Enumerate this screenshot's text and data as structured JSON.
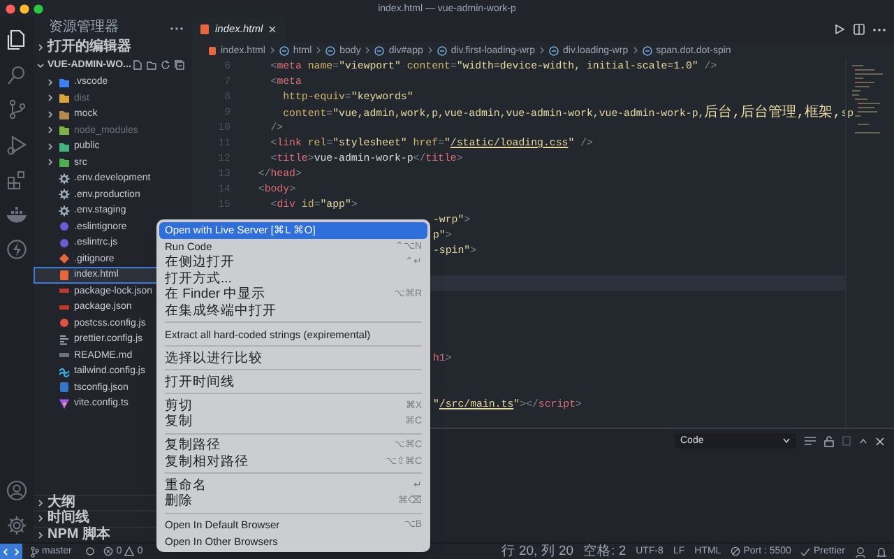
{
  "window": {
    "title": "index.html — vue-admin-work-p"
  },
  "activity_bar": [
    {
      "kind": "files",
      "selected": true
    },
    {
      "kind": "search",
      "selected": false
    },
    {
      "kind": "branch",
      "selected": false
    },
    {
      "kind": "run",
      "selected": false
    },
    {
      "kind": "extensions",
      "selected": false
    },
    {
      "kind": "whale",
      "selected": false
    },
    {
      "kind": "bolt",
      "selected": false
    }
  ],
  "activity_bar_bottom": [
    {
      "kind": "account"
    },
    {
      "kind": "gear"
    }
  ],
  "sidebar": {
    "title": "资源管理器",
    "open_editors": {
      "label": "打开的编辑器",
      "expanded": false
    },
    "project": {
      "label": "VUE-ADMIN-WO...",
      "expanded": true
    },
    "items": [
      {
        "name": ".vscode",
        "kind": "folder",
        "color": "#3b82f6",
        "dimmed": false,
        "selected": false
      },
      {
        "name": "dist",
        "kind": "folder",
        "color": "#d9a53a",
        "dimmed": true,
        "selected": false
      },
      {
        "name": "mock",
        "kind": "folder",
        "color": "#b58a4c",
        "dimmed": false,
        "selected": false
      },
      {
        "name": "node_modules",
        "kind": "folder",
        "color": "#7cb342",
        "dimmed": true,
        "selected": false
      },
      {
        "name": "public",
        "kind": "folder",
        "color": "#43b581",
        "dimmed": false,
        "selected": false
      },
      {
        "name": "src",
        "kind": "folder",
        "color": "#4caf50",
        "dimmed": false,
        "selected": false
      },
      {
        "name": ".env.development",
        "kind": "gear",
        "color": "#9fb0c0",
        "dimmed": false,
        "selected": false
      },
      {
        "name": ".env.production",
        "kind": "gear",
        "color": "#9fb0c0",
        "dimmed": false,
        "selected": false
      },
      {
        "name": ".env.staging",
        "kind": "gear",
        "color": "#9fb0c0",
        "dimmed": false,
        "selected": false
      },
      {
        "name": ".eslintignore",
        "kind": "dot",
        "color": "#6b5bd6",
        "dimmed": false,
        "selected": false
      },
      {
        "name": ".eslintrc.js",
        "kind": "dot",
        "color": "#6b5bd6",
        "dimmed": false,
        "selected": false
      },
      {
        "name": ".gitignore",
        "kind": "diamond",
        "color": "#e8663d",
        "dimmed": false,
        "selected": false
      },
      {
        "name": "index.html",
        "kind": "square",
        "color": "#e8663d",
        "dimmed": false,
        "selected": true
      },
      {
        "name": "package-lock.json",
        "kind": "bar",
        "color": "#c0392b",
        "dimmed": false,
        "selected": false
      },
      {
        "name": "package.json",
        "kind": "bar",
        "color": "#c0392b",
        "dimmed": false,
        "selected": false
      },
      {
        "name": "postcss.config.js",
        "kind": "dot",
        "color": "#e0523c",
        "dimmed": false,
        "selected": false
      },
      {
        "name": "prettier.config.js",
        "kind": "bars",
        "color": "#9ca3af",
        "dimmed": false,
        "selected": false
      },
      {
        "name": "README.md",
        "kind": "bar",
        "color": "#6b7280",
        "dimmed": false,
        "selected": false
      },
      {
        "name": "tailwind.config.js",
        "kind": "wave",
        "color": "#38bdf8",
        "dimmed": false,
        "selected": false
      },
      {
        "name": "tsconfig.json",
        "kind": "square",
        "color": "#3178c6",
        "dimmed": false,
        "selected": false
      },
      {
        "name": "vite.config.ts",
        "kind": "bolt",
        "color": "#a855f7",
        "dimmed": false,
        "selected": false
      }
    ],
    "sections": [
      {
        "label": "大纲",
        "expanded": false
      },
      {
        "label": "时间线",
        "expanded": false
      },
      {
        "label": "NPM 脚本",
        "expanded": false
      }
    ]
  },
  "tabs": [
    {
      "label": "index.html",
      "selected": true
    }
  ],
  "breadcrumbs": [
    "index.html",
    "html",
    "body",
    "div#app",
    "div.first-loading-wrp",
    "div.loading-wrp",
    "span.dot.dot-spin"
  ],
  "code_lines": [
    {
      "number": "6",
      "current": false,
      "tokens": [
        {
          "text": "    <",
          "kind": "punct"
        },
        {
          "text": "meta",
          "kind": "tag"
        },
        {
          "text": " name",
          "kind": "attr"
        },
        {
          "text": "=",
          "kind": "punct"
        },
        {
          "text": "\"viewport\"",
          "kind": "string"
        },
        {
          "text": " content",
          "kind": "attr"
        },
        {
          "text": "=",
          "kind": "punct"
        },
        {
          "text": "\"width=device-width, initial-scale=1.0\"",
          "kind": "string"
        },
        {
          "text": " />",
          "kind": "punct"
        }
      ]
    },
    {
      "number": "7",
      "current": false,
      "tokens": [
        {
          "text": "    <",
          "kind": "punct"
        },
        {
          "text": "meta",
          "kind": "tag"
        }
      ]
    },
    {
      "number": "8",
      "current": false,
      "tokens": [
        {
          "text": "      http-equiv",
          "kind": "attr"
        },
        {
          "text": "=",
          "kind": "punct"
        },
        {
          "text": "\"keywords\"",
          "kind": "string"
        }
      ]
    },
    {
      "number": "9",
      "current": false,
      "tokens": [
        {
          "text": "      content",
          "kind": "attr"
        },
        {
          "text": "=",
          "kind": "punct"
        },
        {
          "text": "\"vue,admin,work,p,vue-admin,vue-admin-work,vue-admin-work-p,",
          "kind": "string"
        },
        {
          "text": "后台,后台管理,框架,",
          "kind": "string"
        },
        {
          "text": "sp",
          "kind": "string"
        }
      ]
    },
    {
      "number": "10",
      "current": false,
      "tokens": [
        {
          "text": "    />",
          "kind": "punct"
        }
      ]
    },
    {
      "number": "11",
      "current": false,
      "tokens": [
        {
          "text": "    <",
          "kind": "punct"
        },
        {
          "text": "link",
          "kind": "tag"
        },
        {
          "text": " rel",
          "kind": "attr"
        },
        {
          "text": "=",
          "kind": "punct"
        },
        {
          "text": "\"stylesheet\"",
          "kind": "string"
        },
        {
          "text": " href",
          "kind": "attr"
        },
        {
          "text": "=",
          "kind": "punct"
        },
        {
          "text": "\"",
          "kind": "string"
        },
        {
          "text": "/static/loading.css",
          "kind": "link"
        },
        {
          "text": "\"",
          "kind": "string"
        },
        {
          "text": " />",
          "kind": "punct"
        }
      ]
    },
    {
      "number": "12",
      "current": false,
      "tokens": [
        {
          "text": "    <",
          "kind": "punct"
        },
        {
          "text": "title",
          "kind": "tag"
        },
        {
          "text": ">",
          "kind": "punct"
        },
        {
          "text": "vue-admin-work-p",
          "kind": "text"
        },
        {
          "text": "</",
          "kind": "punct"
        },
        {
          "text": "title",
          "kind": "tag"
        },
        {
          "text": ">",
          "kind": "punct"
        }
      ]
    },
    {
      "number": "13",
      "current": false,
      "tokens": [
        {
          "text": "  </",
          "kind": "punct"
        },
        {
          "text": "head",
          "kind": "tag"
        },
        {
          "text": ">",
          "kind": "punct"
        }
      ]
    },
    {
      "number": "14",
      "current": false,
      "tokens": [
        {
          "text": "  <",
          "kind": "punct"
        },
        {
          "text": "body",
          "kind": "tag"
        },
        {
          "text": ">",
          "kind": "punct"
        }
      ]
    },
    {
      "number": "15",
      "current": false,
      "tokens": [
        {
          "text": "    <",
          "kind": "punct"
        },
        {
          "text": "div",
          "kind": "tag"
        },
        {
          "text": " id",
          "kind": "attr"
        },
        {
          "text": "=",
          "kind": "punct"
        },
        {
          "text": "\"app\"",
          "kind": "string"
        },
        {
          "text": ">",
          "kind": "punct"
        }
      ]
    },
    {
      "current": false,
      "tail": [
        {
          "text": "-wrp\"",
          "kind": "string"
        },
        {
          "text": ">",
          "kind": "punct"
        }
      ]
    },
    {
      "current": false,
      "tail": [
        {
          "text": "p\"",
          "kind": "string"
        },
        {
          "text": ">",
          "kind": "punct"
        }
      ]
    },
    {
      "current": false,
      "tail": [
        {
          "text": "-spin\"",
          "kind": "string"
        },
        {
          "text": ">",
          "kind": "punct"
        }
      ]
    },
    {
      "current": false
    },
    {
      "current": true
    },
    {
      "current": false
    },
    {
      "current": false
    },
    {
      "current": false
    },
    {
      "current": false
    },
    {
      "current": false,
      "tail": [
        {
          "text": "h1",
          "kind": "tag"
        },
        {
          "text": ">",
          "kind": "punct"
        }
      ]
    },
    {
      "current": false
    },
    {
      "current": false
    },
    {
      "current": false,
      "tail": [
        {
          "text": "\"",
          "kind": "string"
        },
        {
          "text": "/src/main.ts",
          "kind": "link"
        },
        {
          "text": "\"",
          "kind": "string"
        },
        {
          "text": "></",
          "kind": "punct"
        },
        {
          "text": "script",
          "kind": "tag"
        },
        {
          "text": ">",
          "kind": "punct"
        }
      ]
    }
  ],
  "panel": {
    "dropdown": "Code"
  },
  "context_menu": {
    "groups": [
      {
        "items": [
          {
            "label": "Open with Live Server [⌘L ⌘O]",
            "selected": true
          },
          {
            "label": "Run Code",
            "shortcut": "⌃⌥N",
            "selected": false
          },
          {
            "label": "在侧边打开",
            "shortcut": "⌃↵",
            "selected": false
          },
          {
            "label": "打开方式...",
            "selected": false
          },
          {
            "label": "在 Finder 中显示",
            "shortcut": "⌥⌘R",
            "selected": false
          },
          {
            "label": "在集成终端中打开",
            "selected": false
          }
        ]
      },
      {
        "items": [
          {
            "label": "Extract all hard-coded strings (expiremental)",
            "selected": false
          }
        ]
      },
      {
        "items": [
          {
            "label": "选择以进行比较",
            "selected": false
          }
        ]
      },
      {
        "items": [
          {
            "label": "打开时间线",
            "selected": false
          }
        ]
      },
      {
        "items": [
          {
            "label": "剪切",
            "shortcut": "⌘X",
            "selected": false
          },
          {
            "label": "复制",
            "shortcut": "⌘C",
            "selected": false
          }
        ]
      },
      {
        "items": [
          {
            "label": "复制路径",
            "shortcut": "⌥⌘C",
            "selected": false
          },
          {
            "label": "复制相对路径",
            "shortcut": "⌥⇧⌘C",
            "selected": false
          }
        ]
      },
      {
        "items": [
          {
            "label": "重命名",
            "shortcut": "↵",
            "selected": false
          },
          {
            "label": "删除",
            "shortcut": "⌘⌫",
            "selected": false
          }
        ]
      },
      {
        "items": [
          {
            "label": "Open In Default Browser",
            "shortcut": "⌥B",
            "selected": false
          },
          {
            "label": "Open In Other Browsers",
            "selected": false
          }
        ]
      }
    ]
  },
  "status_bar": {
    "branch": "master",
    "errors": "0",
    "warnings": "0",
    "right": [
      "行 20, 列 20",
      "空格: 2",
      "UTF-8",
      "LF",
      "HTML"
    ],
    "port": "Port : 5500",
    "formatter": "Prettier"
  }
}
